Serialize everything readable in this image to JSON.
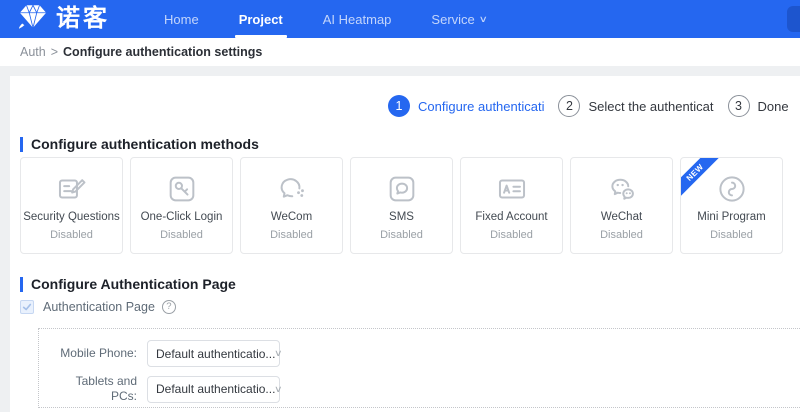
{
  "colors": {
    "primary_blue": "#2567f0",
    "navbar_blue": "#2567f0",
    "disabled_text": "#9aa0a6"
  },
  "icons": {
    "chevron_down": "∨",
    "help": "?"
  },
  "navbar": {
    "logo_text": "诺客",
    "items": [
      {
        "label": "Home",
        "active": false,
        "has_dropdown": false
      },
      {
        "label": "Project",
        "active": true,
        "has_dropdown": false
      },
      {
        "label": "AI Heatmap",
        "active": false,
        "has_dropdown": false
      },
      {
        "label": "Service",
        "active": false,
        "has_dropdown": true
      }
    ]
  },
  "breadcrumb": {
    "parent": "Auth",
    "separator": ">",
    "current": "Configure authentication settings"
  },
  "stepper": {
    "steps": [
      {
        "number": "1",
        "label": "Configure authenticati",
        "state": "active"
      },
      {
        "number": "2",
        "label": "Select the authenticat",
        "state": "pending"
      },
      {
        "number": "3",
        "label": "Done",
        "state": "pending"
      }
    ]
  },
  "methods_section": {
    "title": "Configure authentication methods",
    "cards": [
      {
        "name": "Security Questions",
        "status": "Disabled",
        "icon": "form-edit-icon"
      },
      {
        "name": "One-Click Login",
        "status": "Disabled",
        "icon": "key-icon"
      },
      {
        "name": "WeCom",
        "status": "Disabled",
        "icon": "wecom-icon"
      },
      {
        "name": "SMS",
        "status": "Disabled",
        "icon": "sms-icon"
      },
      {
        "name": "Fixed Account",
        "status": "Disabled",
        "icon": "id-card-icon"
      },
      {
        "name": "WeChat",
        "status": "Disabled",
        "icon": "wechat-icon"
      },
      {
        "name": "Mini Program",
        "status": "Disabled",
        "icon": "mini-program-icon",
        "badge": "NEW"
      }
    ]
  },
  "page_section": {
    "title": "Configure Authentication Page",
    "checkbox_label": "Authentication Page",
    "checkbox_checked": true,
    "fields": [
      {
        "label": "Mobile Phone:",
        "value": "Default authenticatio..."
      },
      {
        "label": "Tablets and PCs:",
        "value": "Default authenticatio..."
      }
    ]
  }
}
